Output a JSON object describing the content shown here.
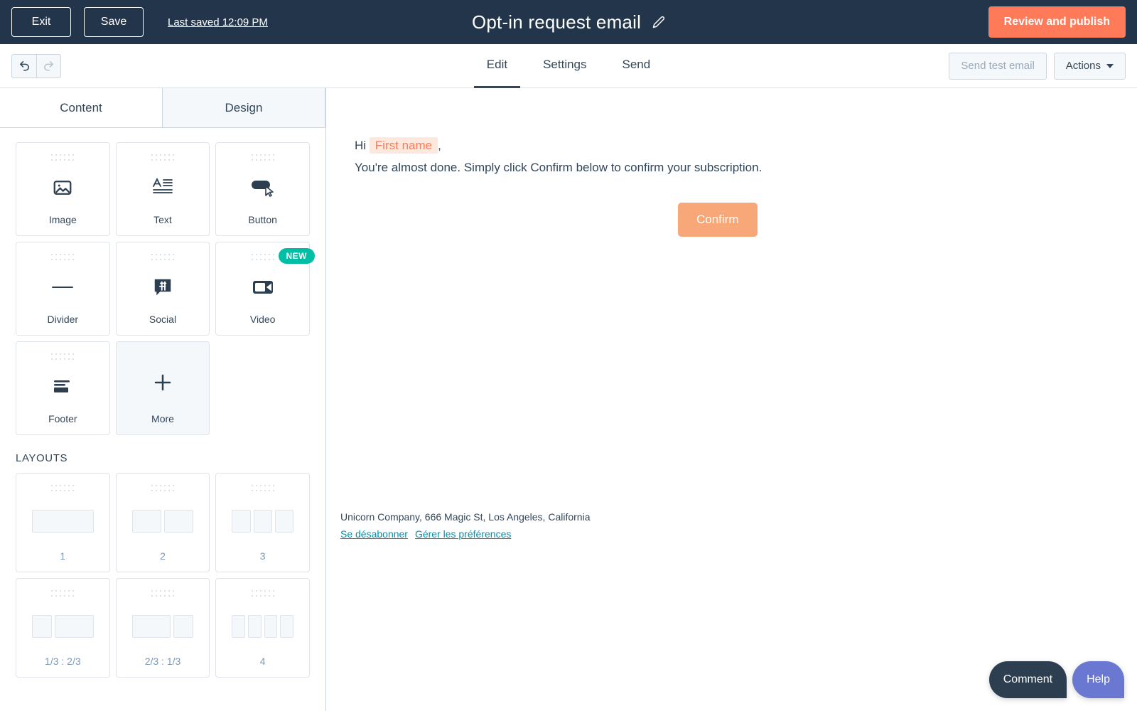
{
  "topbar": {
    "exit_label": "Exit",
    "save_label": "Save",
    "last_saved": "Last saved 12:09 PM",
    "title": "Opt-in request email",
    "edit_title_icon": "pencil-icon",
    "publish_label": "Review and publish",
    "publish_color": "#ff7a59",
    "background_color": "#23354b"
  },
  "subbar": {
    "undo_icon": "undo-arrow-icon",
    "redo_icon": "redo-arrow-icon",
    "tabs": [
      {
        "label": "Edit",
        "active": true
      },
      {
        "label": "Settings",
        "active": false
      },
      {
        "label": "Send",
        "active": false
      }
    ],
    "send_test_label": "Send test email",
    "actions_label": "Actions"
  },
  "sidebar": {
    "tabs": [
      {
        "label": "Content",
        "active": true
      },
      {
        "label": "Design",
        "active": false
      }
    ],
    "blocks": [
      {
        "label": "Image",
        "icon": "image-icon",
        "badge": "",
        "selected": false
      },
      {
        "label": "Text",
        "icon": "text-icon",
        "badge": "",
        "selected": false
      },
      {
        "label": "Button",
        "icon": "button-icon",
        "badge": "",
        "selected": false
      },
      {
        "label": "Divider",
        "icon": "divider-icon",
        "badge": "",
        "selected": false
      },
      {
        "label": "Social",
        "icon": "social-icon",
        "badge": "",
        "selected": false
      },
      {
        "label": "Video",
        "icon": "video-icon",
        "badge": "NEW",
        "selected": false
      },
      {
        "label": "Footer",
        "icon": "footer-icon",
        "badge": "",
        "selected": false
      },
      {
        "label": "More",
        "icon": "plus-icon",
        "badge": "",
        "selected": true
      }
    ],
    "layouts_title": "LAYOUTS",
    "layouts": [
      {
        "label": "1",
        "columns": [
          1
        ]
      },
      {
        "label": "2",
        "columns": [
          1,
          1
        ]
      },
      {
        "label": "3",
        "columns": [
          1,
          1,
          1
        ]
      },
      {
        "label": "1/3 : 2/3",
        "columns": [
          1,
          2
        ]
      },
      {
        "label": "2/3 : 1/3",
        "columns": [
          2,
          1
        ]
      },
      {
        "label": "4",
        "columns": [
          1,
          1,
          1,
          1
        ]
      }
    ],
    "badge_color": "#00bda5"
  },
  "email": {
    "greeting_prefix": "Hi",
    "personalization_token": "First name",
    "greeting_suffix": ",",
    "body_text": "You're almost done. Simply click Confirm below to confirm your subscription.",
    "cta_label": "Confirm",
    "cta_color": "#f8a878",
    "footer_address": "Unicorn Company, 666 Magic St, Los Angeles, California",
    "footer_links": [
      "Se désabonner",
      "Gérer les préférences"
    ],
    "link_color": "#0091ae"
  },
  "floating": {
    "comment_label": "Comment",
    "comment_color": "#2d3e50",
    "help_label": "Help",
    "help_color": "#6a78d1"
  }
}
